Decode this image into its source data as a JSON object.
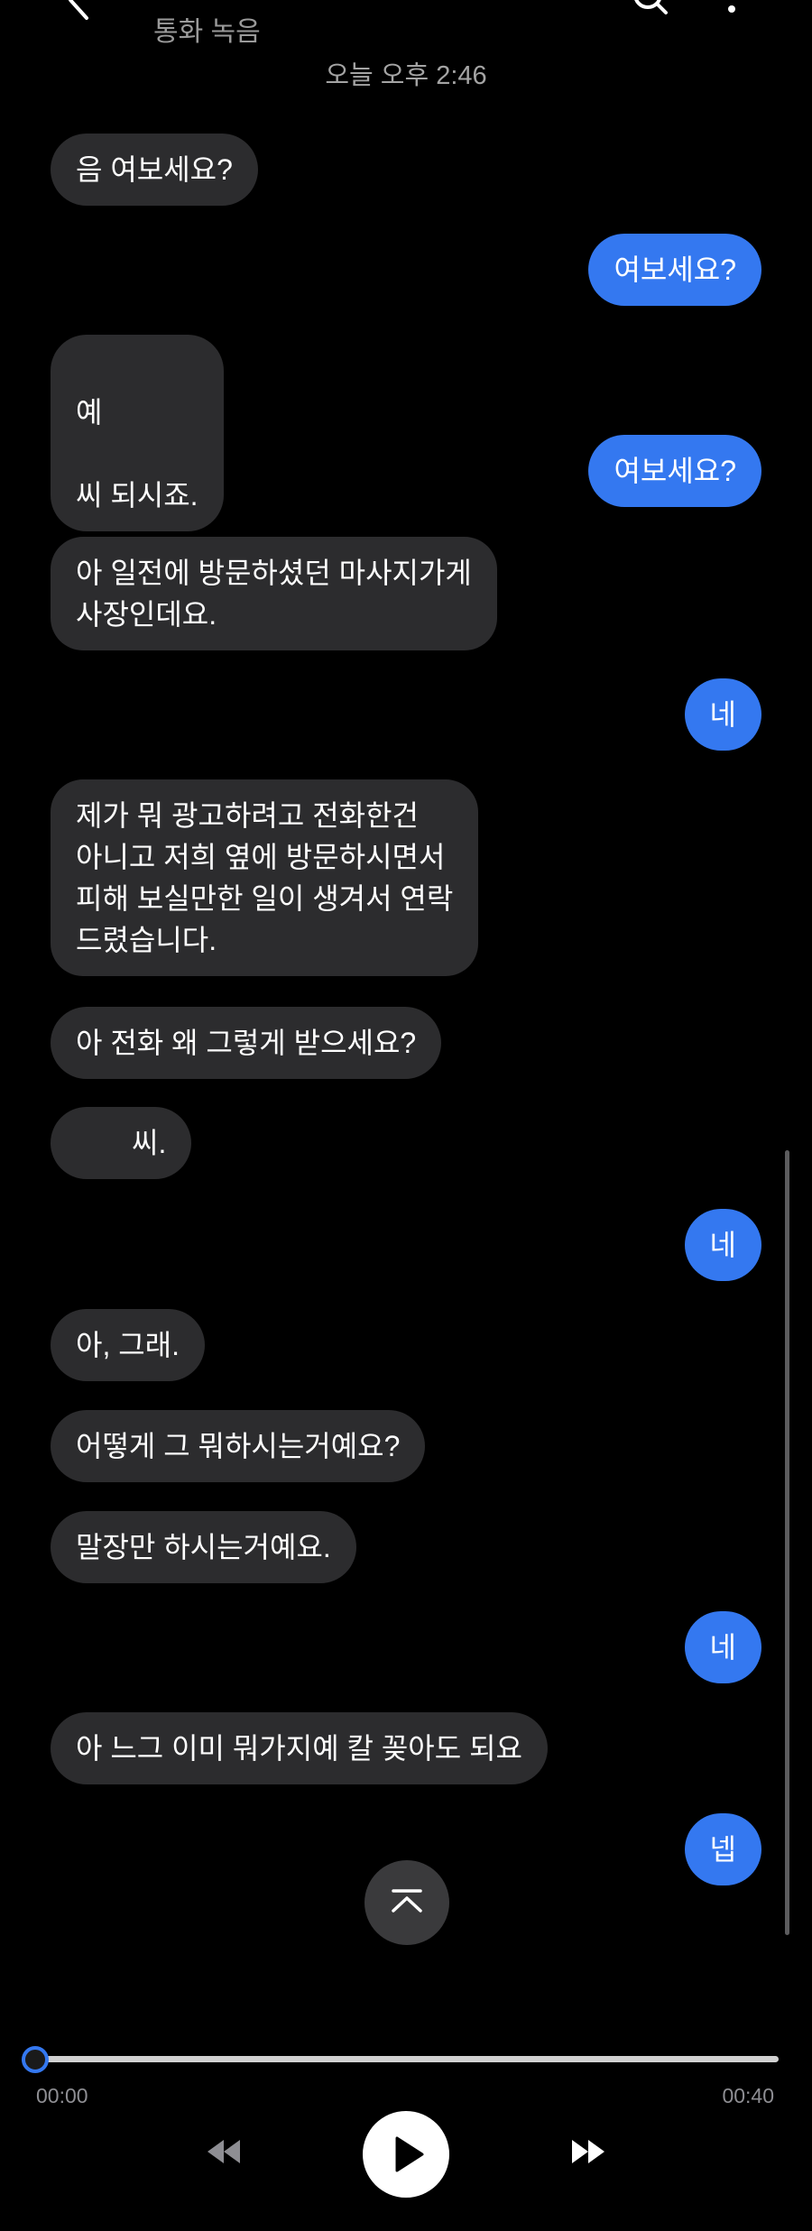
{
  "header": {
    "subtitle": "통화 녹음",
    "timestamp": "오늘 오후 2:46"
  },
  "messages": [
    {
      "side": "left",
      "text": "음 여보세요?"
    },
    {
      "side": "right",
      "text": "여보세요?"
    },
    {
      "side": "left",
      "text_before": "예",
      "text_after": "씨 되시죠."
    },
    {
      "side": "right",
      "text": "여보세요?"
    },
    {
      "side": "left",
      "text": "아 일전에 방문하셨던 마사지가게\n사장인데요."
    },
    {
      "side": "right",
      "text": "네"
    },
    {
      "side": "left",
      "text": "제가 뭐 광고하려고 전화한건\n아니고 저희 옆에 방문하시면서\n피해 보실만한 일이 생겨서 연락\n드렸습니다."
    },
    {
      "side": "left",
      "text": "아 전화 왜 그렇게 받으세요?"
    },
    {
      "side": "left",
      "text": "씨."
    },
    {
      "side": "right",
      "text": "네"
    },
    {
      "side": "left",
      "text": "아, 그래."
    },
    {
      "side": "left",
      "text": "어떻게 그 뭐하시는거예요?"
    },
    {
      "side": "left",
      "text": "말장만 하시는거예요."
    },
    {
      "side": "right",
      "text": "네"
    },
    {
      "side": "left",
      "text": "아 느그 이미 뭐가지예 칼 꽂아도 되요"
    },
    {
      "side": "right",
      "text": "넵"
    }
  ],
  "player": {
    "current_time": "00:00",
    "total_time": "00:40",
    "progress": 0
  },
  "colors": {
    "background": "#000000",
    "incoming_bubble": "#2c2c2e",
    "outgoing_bubble": "#3478f0",
    "accent": "#3478f0"
  },
  "icons": {
    "back": "back-arrow-icon",
    "search": "search-icon",
    "more": "more-vertical-icon",
    "scroll_top": "chevron-up-icon",
    "rewind": "rewind-icon",
    "play": "play-icon",
    "forward": "fast-forward-icon"
  }
}
